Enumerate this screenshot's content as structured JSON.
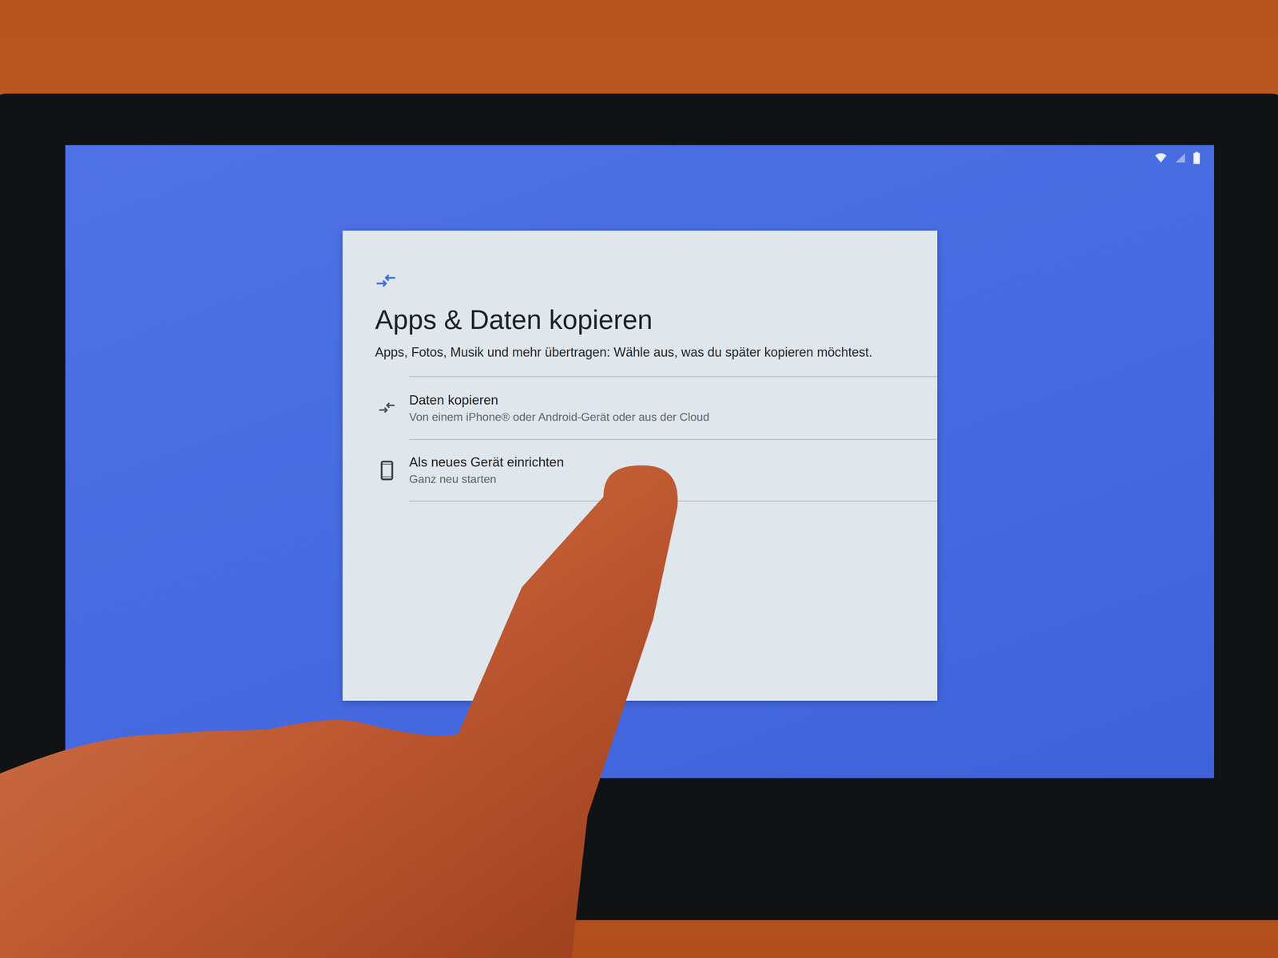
{
  "screen": {
    "title": "Apps & Daten kopieren",
    "description": "Apps, Fotos, Musik und mehr übertragen: Wähle aus, was du später kopieren möchtest.",
    "options": [
      {
        "title": "Daten kopieren",
        "subtitle": "Von einem iPhone® oder Android-Gerät oder aus der Cloud",
        "kind": "copy"
      },
      {
        "title": "Als neues Gerät einrichten",
        "subtitle": "Ganz neu starten",
        "kind": "new"
      }
    ]
  }
}
